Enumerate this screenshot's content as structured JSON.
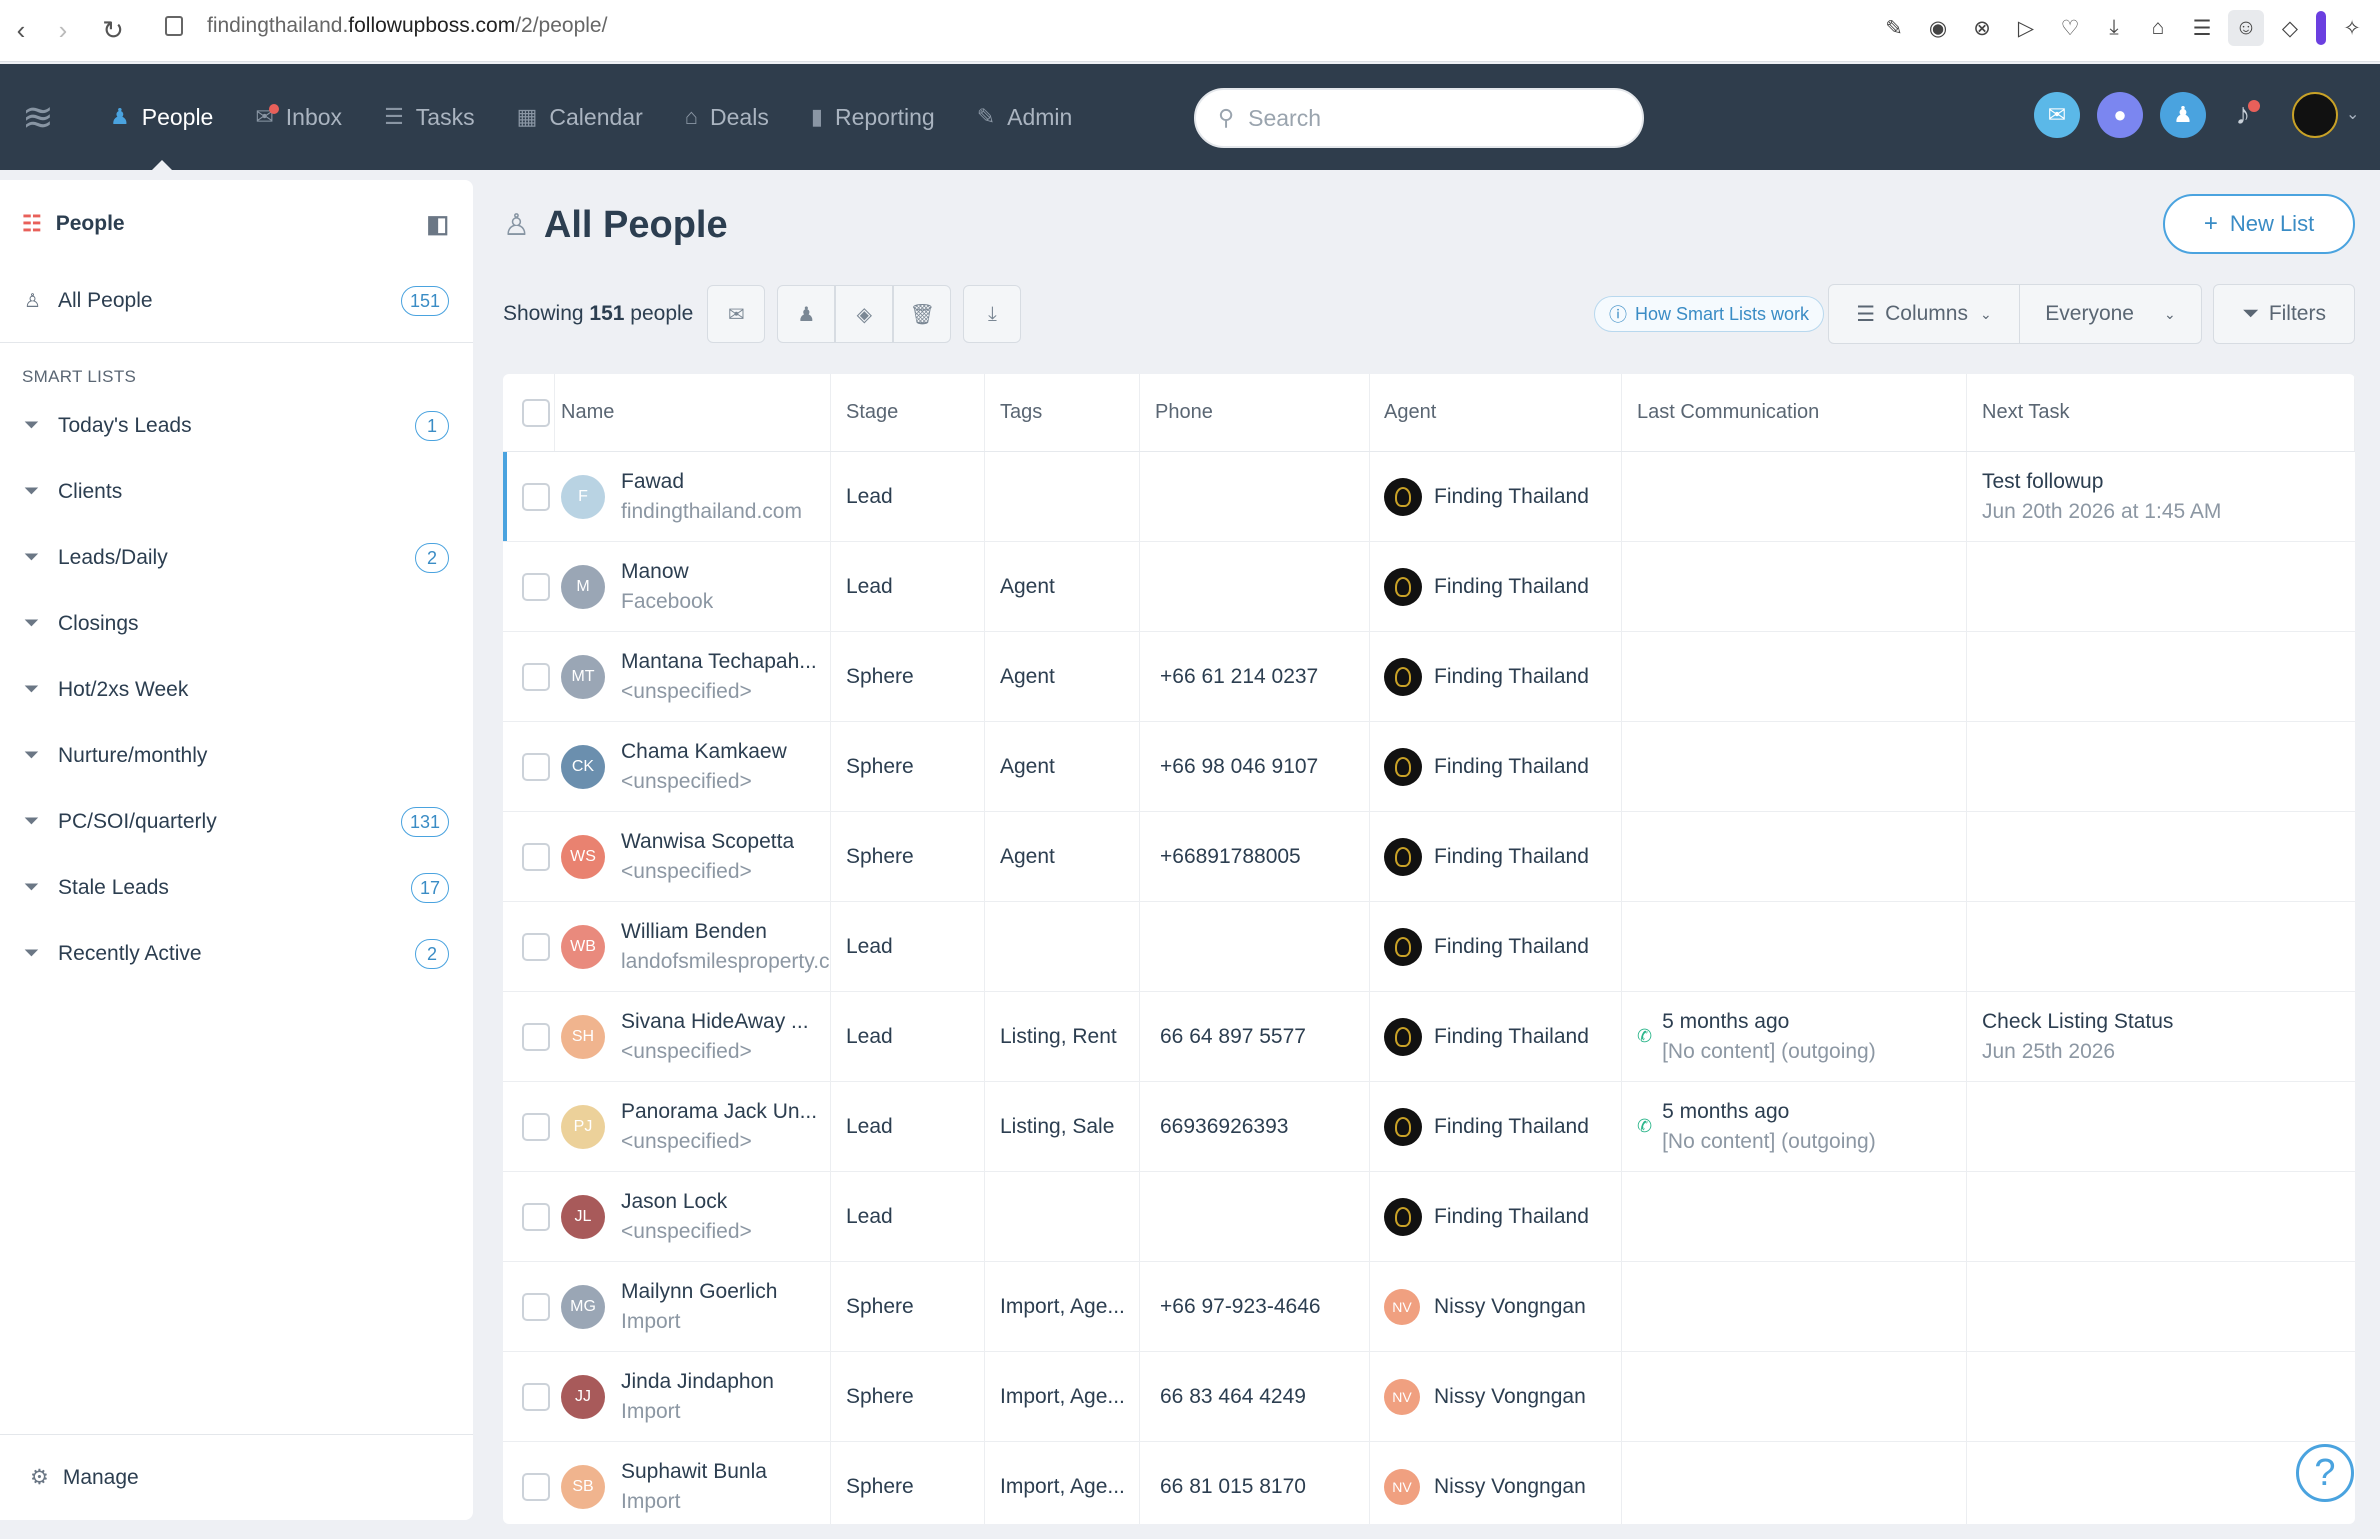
{
  "browser": {
    "url_pre": "findingthailand.",
    "url_host": "followupboss.com",
    "url_path": "/2/people/"
  },
  "nav": {
    "items": [
      {
        "label": "People",
        "icon": "people-icon"
      },
      {
        "label": "Inbox",
        "icon": "inbox-icon"
      },
      {
        "label": "Tasks",
        "icon": "tasks-icon"
      },
      {
        "label": "Calendar",
        "icon": "calendar-icon"
      },
      {
        "label": "Deals",
        "icon": "deals-icon"
      },
      {
        "label": "Reporting",
        "icon": "reporting-icon"
      },
      {
        "label": "Admin",
        "icon": "admin-icon"
      }
    ],
    "search_placeholder": "Search"
  },
  "sidebar": {
    "title": "People",
    "all_people": {
      "label": "All People",
      "count": "151"
    },
    "section": "SMART LISTS",
    "lists": [
      {
        "label": "Today's Leads",
        "count": "1"
      },
      {
        "label": "Clients",
        "count": ""
      },
      {
        "label": "Leads/Daily",
        "count": "2"
      },
      {
        "label": "Closings",
        "count": ""
      },
      {
        "label": "Hot/2xs Week",
        "count": ""
      },
      {
        "label": "Nurture/monthly",
        "count": ""
      },
      {
        "label": "PC/SOI/quarterly",
        "count": "131"
      },
      {
        "label": "Stale Leads",
        "count": "17"
      },
      {
        "label": "Recently Active",
        "count": "2"
      }
    ],
    "manage": "Manage"
  },
  "main": {
    "title": "All People",
    "new_list": "New List",
    "showing_pre": "Showing",
    "showing_count": "151",
    "showing_post": "people",
    "how_smart": "How Smart Lists work",
    "columns": "Columns",
    "everyone": "Everyone",
    "filters": "Filters"
  },
  "table": {
    "headers": [
      "Name",
      "Stage",
      "Tags",
      "Phone",
      "Agent",
      "Last Communication",
      "Next Task"
    ],
    "rows": [
      {
        "initials": "F",
        "color": "#b9d3e3",
        "name": "Fawad",
        "source": "findingthailand.com",
        "stage": "Lead",
        "tags": "",
        "phone": "",
        "agent": "Finding Thailand",
        "agent_type": "logo",
        "last1": "",
        "last2": "",
        "next1": "Test followup",
        "next2": "Jun 20th 2026 at 1:45 AM"
      },
      {
        "initials": "M",
        "color": "#9aa6b5",
        "name": "Manow",
        "source": "Facebook",
        "stage": "Lead",
        "tags": "Agent",
        "phone": "",
        "agent": "Finding Thailand",
        "agent_type": "logo",
        "last1": "",
        "last2": "",
        "next1": "",
        "next2": ""
      },
      {
        "initials": "MT",
        "color": "#9aa6b5",
        "name": "Mantana Techapah...",
        "source": "<unspecified>",
        "stage": "Sphere",
        "tags": "Agent",
        "phone": "+66 61 214 0237",
        "agent": "Finding Thailand",
        "agent_type": "logo",
        "last1": "",
        "last2": "",
        "next1": "",
        "next2": ""
      },
      {
        "initials": "CK",
        "color": "#6b8fae",
        "name": "Chama Kamkaew",
        "source": "<unspecified>",
        "stage": "Sphere",
        "tags": "Agent",
        "phone": "+66 98 046 9107",
        "agent": "Finding Thailand",
        "agent_type": "logo",
        "last1": "",
        "last2": "",
        "next1": "",
        "next2": ""
      },
      {
        "initials": "WS",
        "color": "#e98270",
        "name": "Wanwisa Scopetta",
        "source": "<unspecified>",
        "stage": "Sphere",
        "tags": "Agent",
        "phone": "+66891788005",
        "agent": "Finding Thailand",
        "agent_type": "logo",
        "last1": "",
        "last2": "",
        "next1": "",
        "next2": ""
      },
      {
        "initials": "WB",
        "color": "#e98a7d",
        "name": "William Benden",
        "source": "landofsmilesproperty.c",
        "stage": "Lead",
        "tags": "",
        "phone": "",
        "agent": "Finding Thailand",
        "agent_type": "logo",
        "last1": "",
        "last2": "",
        "next1": "",
        "next2": ""
      },
      {
        "initials": "SH",
        "color": "#f0b48e",
        "name": "Sivana HideAway ...",
        "source": "<unspecified>",
        "stage": "Lead",
        "tags": "Listing, Rent",
        "phone": "66 64 897 5577",
        "agent": "Finding Thailand",
        "agent_type": "logo",
        "last1": "5 months ago",
        "last2": "[No content] (outgoing)",
        "next1": "Check Listing Status",
        "next2": "Jun 25th 2026"
      },
      {
        "initials": "PJ",
        "color": "#ecd19a",
        "name": "Panorama Jack Un...",
        "source": "<unspecified>",
        "stage": "Lead",
        "tags": "Listing, Sale",
        "phone": "66936926393",
        "agent": "Finding Thailand",
        "agent_type": "logo",
        "last1": "5 months ago",
        "last2": "[No content] (outgoing)",
        "next1": "",
        "next2": ""
      },
      {
        "initials": "JL",
        "color": "#a85a5a",
        "name": "Jason Lock",
        "source": "<unspecified>",
        "stage": "Lead",
        "tags": "",
        "phone": "",
        "agent": "Finding Thailand",
        "agent_type": "logo",
        "last1": "",
        "last2": "",
        "next1": "",
        "next2": ""
      },
      {
        "initials": "MG",
        "color": "#9aa6b5",
        "name": "Mailynn Goerlich",
        "source": "Import",
        "stage": "Sphere",
        "tags": "Import, Age...",
        "phone": "+66 97-923-4646",
        "agent": "Nissy Vongngan",
        "agent_type": "nv",
        "last1": "",
        "last2": "",
        "next1": "",
        "next2": ""
      },
      {
        "initials": "JJ",
        "color": "#a85a5a",
        "name": "Jinda Jindaphon",
        "source": "Import",
        "stage": "Sphere",
        "tags": "Import, Age...",
        "phone": "66 83 464 4249",
        "agent": "Nissy Vongngan",
        "agent_type": "nv",
        "last1": "",
        "last2": "",
        "next1": "",
        "next2": ""
      },
      {
        "initials": "SB",
        "color": "#f0b48e",
        "name": "Suphawit Bunla",
        "source": "Import",
        "stage": "Sphere",
        "tags": "Import, Age...",
        "phone": "66 81 015 8170",
        "agent": "Nissy Vongngan",
        "agent_type": "nv",
        "last1": "",
        "last2": "",
        "next1": "",
        "next2": ""
      }
    ]
  }
}
